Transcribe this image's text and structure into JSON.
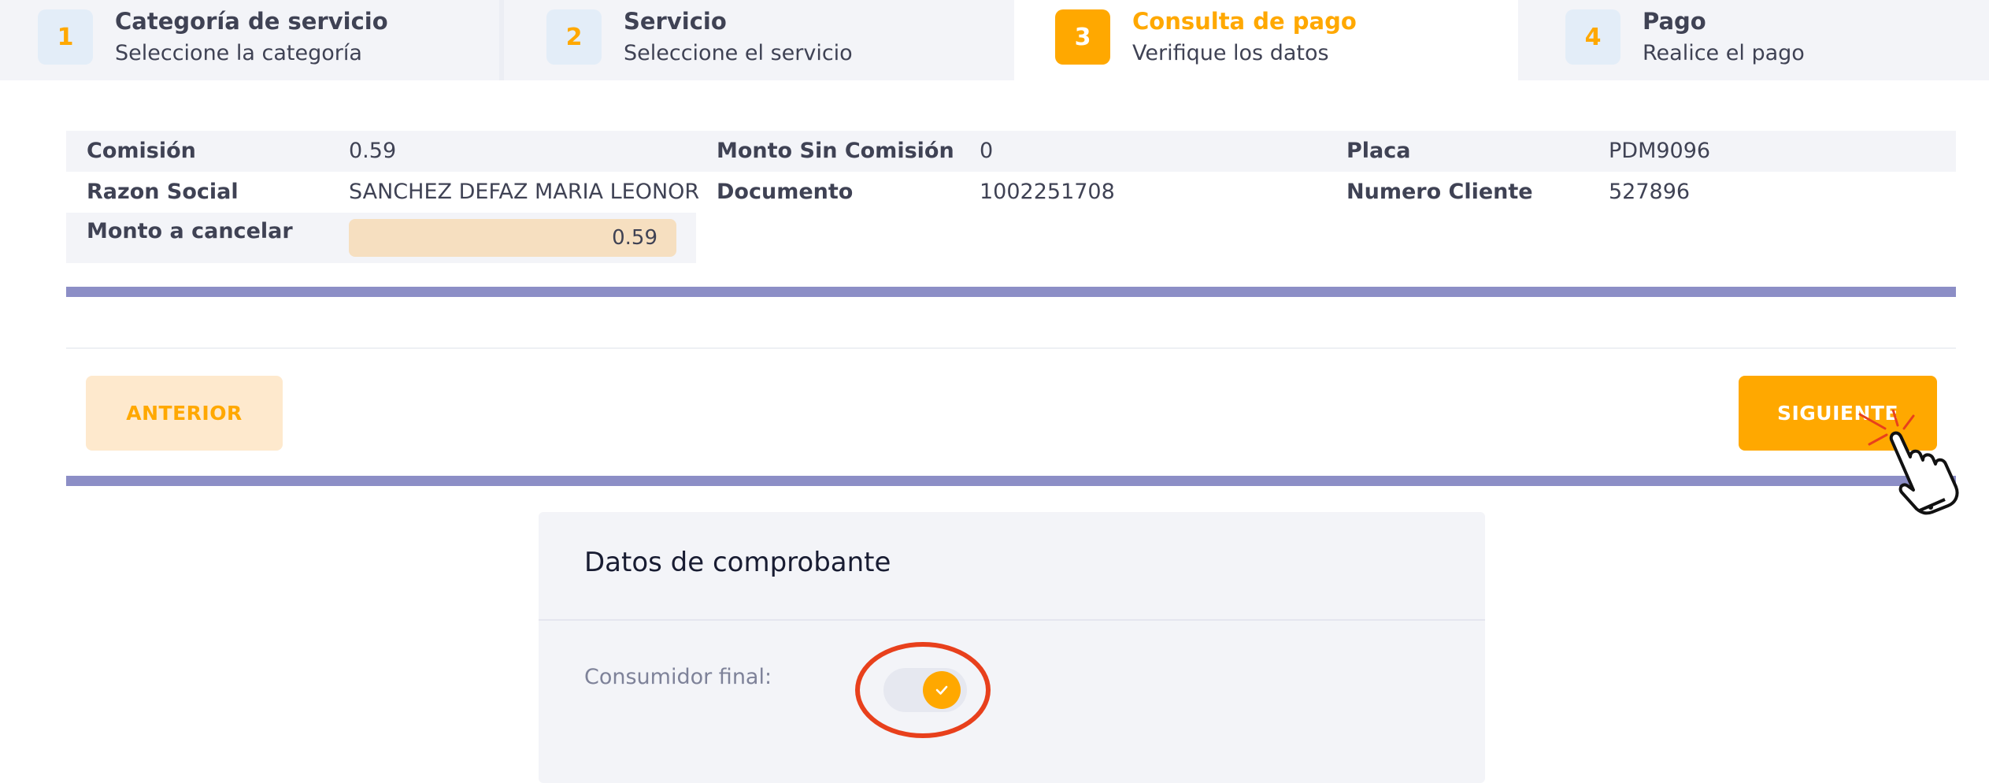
{
  "stepper": {
    "steps": [
      {
        "number": "1",
        "title": "Categoría de servicio",
        "subtitle": "Seleccione la categoría",
        "active": false
      },
      {
        "number": "2",
        "title": "Servicio",
        "subtitle": "Seleccione el servicio",
        "active": false
      },
      {
        "number": "3",
        "title": "Consulta de pago",
        "subtitle": "Verifique los datos",
        "active": true
      },
      {
        "number": "4",
        "title": "Pago",
        "subtitle": "Realice el pago",
        "active": false
      }
    ]
  },
  "info": {
    "comision_label": "Comisión",
    "comision_value": "0.59",
    "monto_sin_comision_label": "Monto Sin Comisión",
    "monto_sin_comision_value": "0",
    "placa_label": "Placa",
    "placa_value": "PDM9096",
    "razon_social_label": "Razon Social",
    "razon_social_value": "SANCHEZ DEFAZ MARIA LEONOR",
    "documento_label": "Documento",
    "documento_value": "1002251708",
    "numero_cliente_label": "Numero Cliente",
    "numero_cliente_value": "527896",
    "monto_cancelar_label": "Monto a cancelar",
    "monto_cancelar_value": "0.59"
  },
  "actions": {
    "prev_label": "ANTERIOR",
    "next_label": "SIGUIENTE"
  },
  "comprobante": {
    "title": "Datos de comprobante",
    "consumidor_final_label": "Consumidor final:",
    "consumidor_final_checked": true
  },
  "colors": {
    "accent": "#ffa800",
    "accent_light": "#fee9cd",
    "divider_bar": "#8c8ec6",
    "highlight": "#e8401c"
  }
}
